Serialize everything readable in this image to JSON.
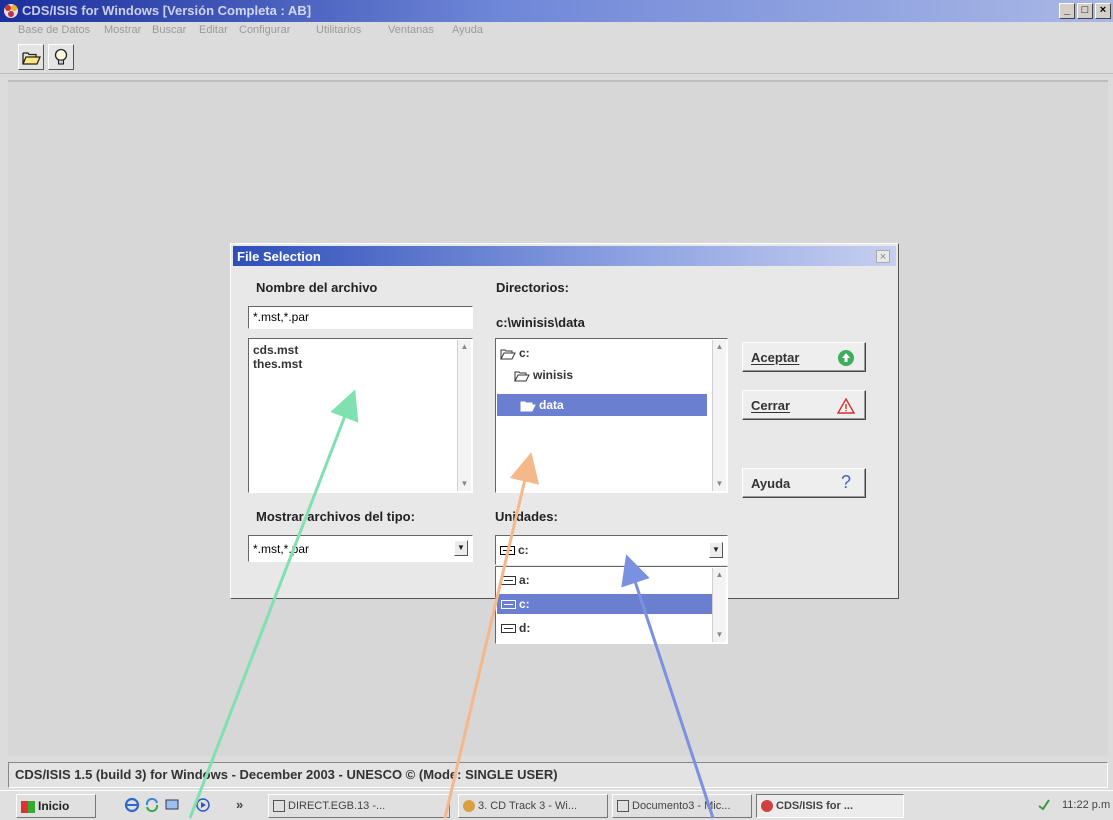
{
  "window": {
    "title": "CDS/ISIS for Windows [Versión Completa : AB]",
    "controls": [
      "_",
      "□",
      "×"
    ]
  },
  "menu": [
    "Base de Datos",
    "Mostrar",
    "Buscar",
    "Editar",
    "Configurar",
    "Utilitarios",
    "Ventanas",
    "Ayuda"
  ],
  "dialog": {
    "title": "File Selection",
    "close": "×",
    "filename_label": "Nombre del archivo",
    "filename_value": "*.mst,*.par",
    "files": [
      "cds.mst",
      "thes.mst"
    ],
    "directories_label": "Directorios:",
    "current_path": "c:\\winisis\\data",
    "directories": [
      {
        "name": "c:",
        "selected": false
      },
      {
        "name": "winisis",
        "selected": false
      },
      {
        "name": "data",
        "selected": true
      }
    ],
    "filetype_label": "Mostrar archivos del tipo:",
    "filetype_value": "*.mst,*.par",
    "drives_label": "Unidades:",
    "drive_value": "c:",
    "drives": [
      {
        "name": "a:",
        "selected": false
      },
      {
        "name": "c:",
        "selected": true
      },
      {
        "name": "d:",
        "selected": false
      }
    ],
    "buttons": {
      "accept": "Aceptar",
      "close": "Cerrar",
      "help": "Ayuda",
      "help_icon": "?"
    }
  },
  "status": "CDS/ISIS 1.5 (build 3) for Windows - December 2003 - UNESCO © (Mode: SINGLE USER)",
  "taskbar": {
    "start": "Inicio",
    "chevron": "»",
    "tasks": [
      "DIRECT.EGB.13 -...",
      "3. CD Track 3 - Wi...",
      "Documento3 - Mic...",
      "CDS/ISIS for ..."
    ],
    "clock": "11:22 p.m."
  },
  "colors": {
    "title_gradient_start": "#1b2f9c",
    "selection": "#6a7fcf",
    "arrow_green": "#7fe0b0",
    "arrow_orange": "#f4b88a",
    "arrow_blue": "#7a90e0"
  }
}
